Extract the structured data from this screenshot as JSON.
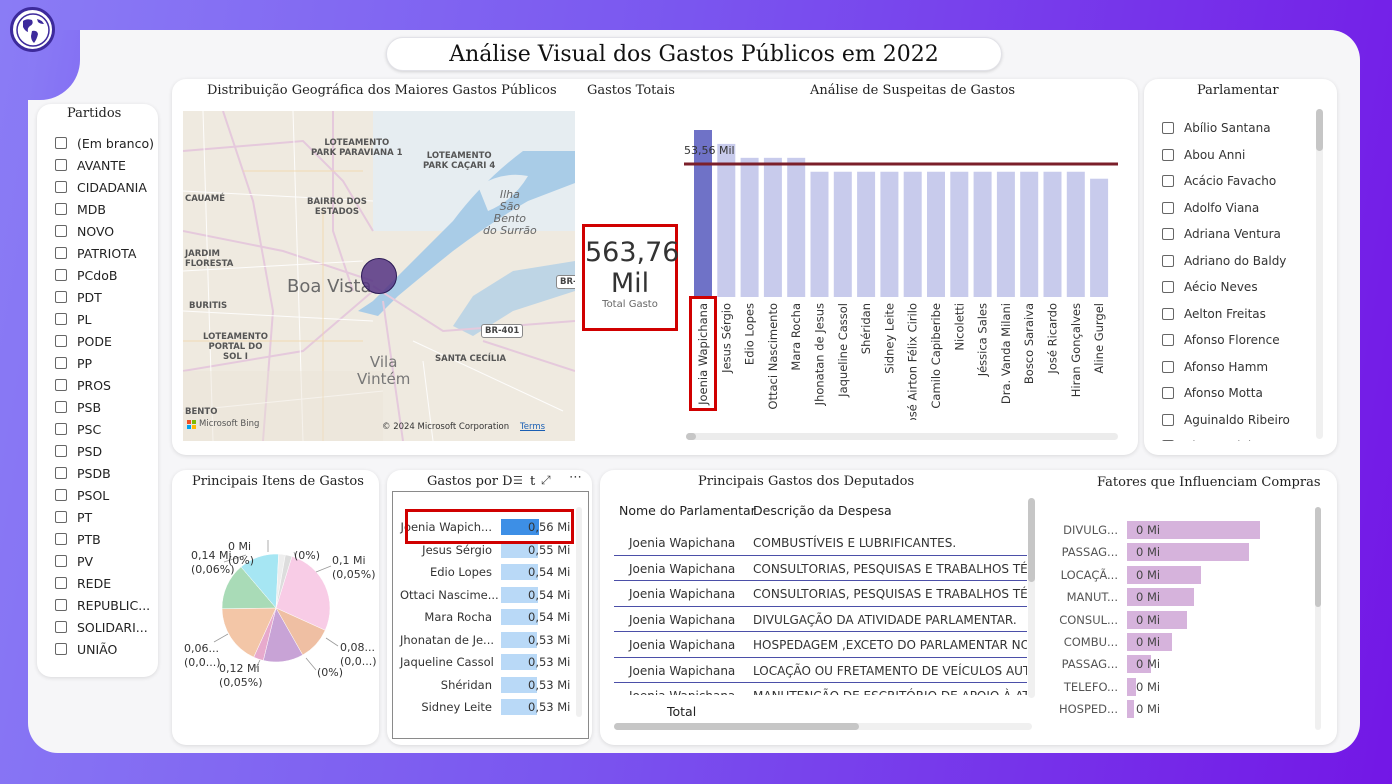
{
  "title": "Análise Visual dos Gastos Públicos em 2022",
  "partidos": {
    "title": "Partidos",
    "items": [
      "(Em branco)",
      "AVANTE",
      "CIDADANIA",
      "MDB",
      "NOVO",
      "PATRIOTA",
      "PCdoB",
      "PDT",
      "PL",
      "PODE",
      "PP",
      "PROS",
      "PSB",
      "PSC",
      "PSD",
      "PSDB",
      "PSOL",
      "PT",
      "PTB",
      "PV",
      "REDE",
      "REPUBLIC...",
      "SOLIDARI...",
      "UNIÃO"
    ]
  },
  "map": {
    "title": "Distribuição Geográfica dos Maiores Gastos Públicos",
    "city_label": "Boa Vista",
    "labels": {
      "loteamento_paraviana": "LOTEAMENTO\nPARK PARAVIANA 1",
      "loteamento_cacari": "LOTEAMENTO\nPARK CAÇARI 4",
      "cauame": "CAUAMÉ",
      "bairro_estados": "BAIRRO DOS\nESTADOS",
      "ilha": "Ilha\nSão\nBento\ndo Surrão",
      "jardim_floresta": "JARDIM\nFLORESTA",
      "buritis": "BURITIS",
      "portal": "LOTEAMENTO\nPORTAL DO\nSOL I",
      "vila_vintem": "Vila\nVintém",
      "santa_cecilia": "SANTA CECÍLIA",
      "br401": "BR-401",
      "br_edge": "BR-",
      "bento": "BENTO"
    },
    "bing_label": "Microsoft Bing",
    "copyright": "© 2024 Microsoft Corporation",
    "terms": "Terms"
  },
  "kpi": {
    "title": "Gastos Totais",
    "value_line1": "563,76",
    "value_line2": "Mil",
    "label": "Total Gasto"
  },
  "suspeitas": {
    "title": "Análise de Suspeitas de Gastos",
    "reference_label": "53,56 Mil"
  },
  "parlamentar": {
    "title": "Parlamentar",
    "items": [
      "Abílio Santana",
      "Abou Anni",
      "Acácio Favacho",
      "Adolfo Viana",
      "Adriana Ventura",
      "Adriano do Baldy",
      "Aécio Neves",
      "Aelton Freitas",
      "Afonso Florence",
      "Afonso Hamm",
      "Afonso Motta",
      "Aguinaldo Ribeiro",
      "Airton Faleiro"
    ]
  },
  "itens": {
    "title": "Principais Itens de Gastos",
    "labels": {
      "top_left": "0,14 Mi\n(0,06%)",
      "top_mid": "0 Mi\n(0%)",
      "top_pct": "(0%)",
      "top_right": "0,1 Mi\n(0,05%)",
      "right": "0,08...\n(0,0...)",
      "bottom_pct": "(0%)",
      "bottom": "0,12 Mi\n(0,05%)",
      "left": "0,06...\n(0,0...)"
    }
  },
  "gastos_por": {
    "title": "Gastos por D",
    "title_tail": "t"
  },
  "deputados": {
    "title": "Principais Gastos dos Deputados",
    "col_nome": "Nome do Parlamentar",
    "col_desc": "Descrição da Despesa",
    "rows": [
      {
        "nome": "Joenia Wapichana",
        "desc": "COMBUSTÍVEIS E LUBRIFICANTES."
      },
      {
        "nome": "Joenia Wapichana",
        "desc": "CONSULTORIAS, PESQUISAS E TRABALHOS TÉCN"
      },
      {
        "nome": "Joenia Wapichana",
        "desc": "CONSULTORIAS, PESQUISAS E TRABALHOS TÉCN"
      },
      {
        "nome": "Joenia Wapichana",
        "desc": "DIVULGAÇÃO DA ATIVIDADE PARLAMENTAR."
      },
      {
        "nome": "Joenia Wapichana",
        "desc": "HOSPEDAGEM ,EXCETO DO PARLAMENTAR NO D"
      },
      {
        "nome": "Joenia Wapichana",
        "desc": "LOCAÇÃO OU FRETAMENTO DE VEÍCULOS AUTO"
      },
      {
        "nome": "Joenia Wapichana",
        "desc": "MANUTENÇÃO DE ESCRITÓRIO DE APOIO À ATIV"
      }
    ],
    "total_label": "Total"
  },
  "fatores": {
    "title": "Fatores que Influenciam Compras"
  },
  "colors": {
    "bar_highlight": "#6f72c7",
    "bar_normal": "#c8cbec",
    "reference_line": "#7b1f2a",
    "hbar_selected": "#3d8fe6",
    "hbar_normal": "#b9d9f7",
    "fatores_bar": "#d6b3dc",
    "highlight_border": "#d00000"
  },
  "chart_data": [
    {
      "type": "bar",
      "title": "Análise de Suspeitas de Gastos",
      "categories": [
        "Joenia Wapichana",
        "Jesus Sérgio",
        "Edio Lopes",
        "Ottaci Nascimento",
        "Mara Rocha",
        "Jhonatan de Jesus",
        "Jaqueline Cassol",
        "Shéridan",
        "Sidney Leite",
        "José Airton Félix Cirilo",
        "Camilo Capiberibe",
        "Nicoletti",
        "Jéssica Sales",
        "Dra. Vanda Milani",
        "Bosco Saraiva",
        "José Ricardo",
        "Hiran Gonçalves",
        "Aline Gurgel"
      ],
      "values": [
        56,
        55,
        54,
        54,
        54,
        53,
        53,
        53,
        53,
        53,
        53,
        53,
        53,
        53,
        53,
        53,
        53,
        52.5
      ],
      "reference_line": {
        "label": "53,56 Mil",
        "value": 53.56
      },
      "ylim": [
        0,
        56
      ],
      "grid": false
    },
    {
      "type": "bar",
      "orientation": "horizontal",
      "title": "Gastos por D",
      "categories": [
        "Joenia Wapich...",
        "Jesus Sérgio",
        "Edio Lopes",
        "Ottaci Nascime...",
        "Mara Rocha",
        "Jhonatan de Je...",
        "Jaqueline Cassol",
        "Shéridan",
        "Sidney Leite"
      ],
      "values": [
        0.56,
        0.55,
        0.54,
        0.54,
        0.54,
        0.53,
        0.53,
        0.53,
        0.53
      ],
      "value_labels": [
        "0,56 Mi",
        "0,55 Mi",
        "0,54 Mi",
        "0,54 Mi",
        "0,54 Mi",
        "0,53 Mi",
        "0,53 Mi",
        "0,53 Mi",
        "0,53 Mi"
      ]
    },
    {
      "type": "bar",
      "orientation": "horizontal",
      "title": "Fatores que Influenciam Compras",
      "categories": [
        "DIVULG...",
        "PASSAG...",
        "LOCAÇÃ...",
        "MANUT...",
        "CONSUL...",
        "COMBU...",
        "PASSAG...",
        "TELEFO...",
        "HOSPED..."
      ],
      "values": [
        1.0,
        0.92,
        0.56,
        0.5,
        0.45,
        0.34,
        0.18,
        0.07,
        0.05
      ],
      "value_labels": [
        "0 Mi",
        "0 Mi",
        "0 Mi",
        "0 Mi",
        "0 Mi",
        "0 Mi",
        "0 Mi",
        "0 Mi",
        "0 Mi"
      ]
    },
    {
      "type": "pie",
      "title": "Principais Itens de Gastos",
      "values": [
        0.14,
        0.1,
        0.08,
        0.0,
        0.12,
        0.06,
        0.0,
        0.0,
        0.0
      ],
      "slice_colors": [
        "#f8cce6",
        "#efbfa3",
        "#c8a3d6",
        "#e7aacd",
        "#f3c6a7",
        "#a9dbb7",
        "#a6e6f3",
        "#eee",
        "#ddd"
      ]
    }
  ]
}
